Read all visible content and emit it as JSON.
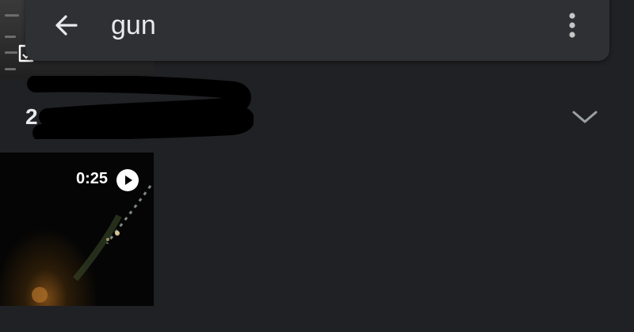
{
  "search": {
    "query": "gun"
  },
  "section": {
    "date_label": "2"
  },
  "video": {
    "duration": "0:25"
  },
  "icons": {
    "back": "arrow-back-icon",
    "more": "more-vert-icon",
    "expand": "chevron-down-icon",
    "play": "play-circle-icon",
    "saved": "save-to-device-icon"
  },
  "colors": {
    "background": "#202124",
    "search_card": "#2f3033",
    "text": "#e8eaed"
  }
}
